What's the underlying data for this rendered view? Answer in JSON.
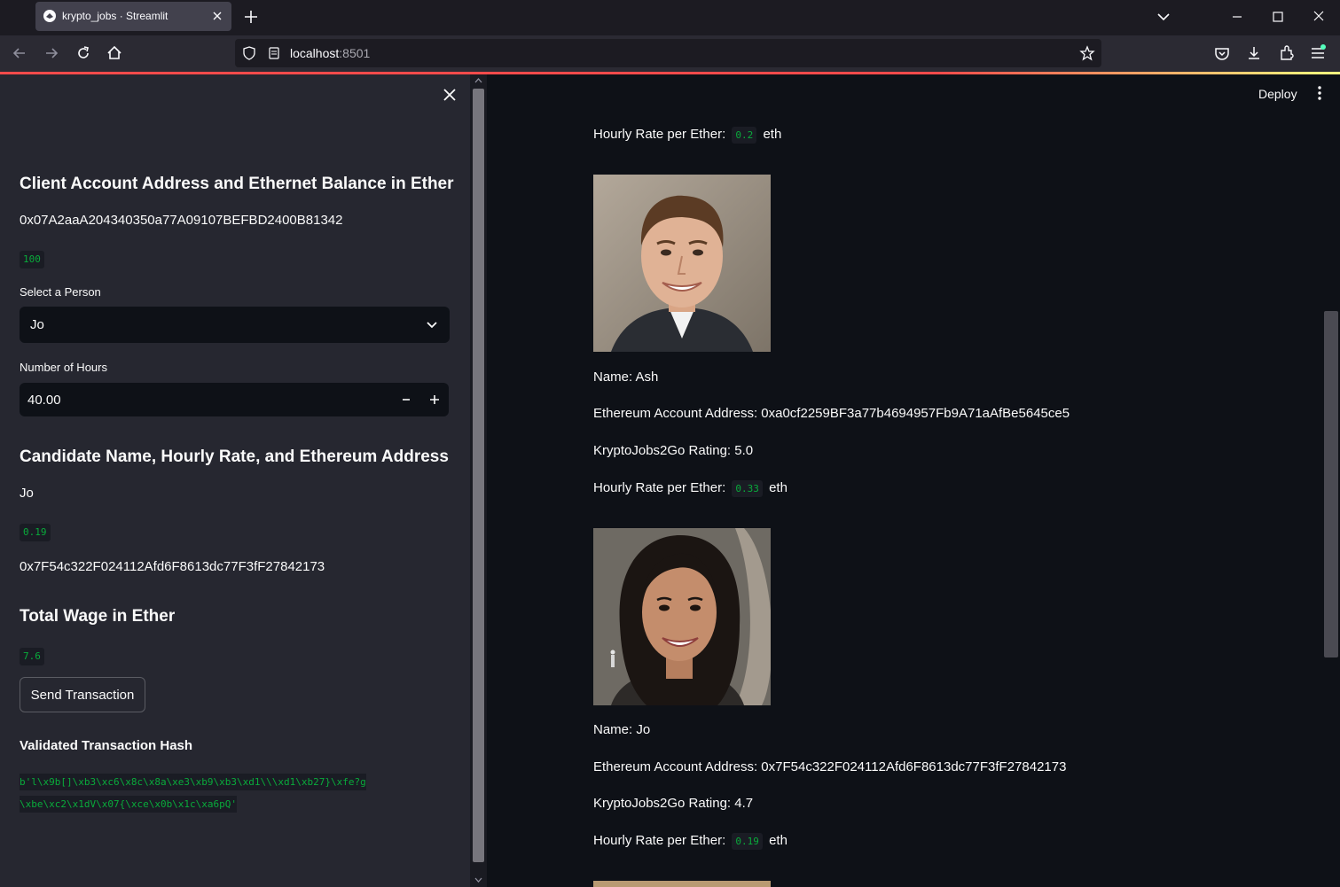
{
  "browser": {
    "tab_title": "krypto_jobs · Streamlit",
    "url_host": "localhost",
    "url_port": ":8501"
  },
  "sidebar": {
    "client_heading": "Client Account Address and Ethernet Balance in Ether",
    "client_address": "0x07A2aaA204340350a77A09107BEFBD2400B81342",
    "client_balance": "100",
    "select_person_label": "Select a Person",
    "select_person_value": "Jo",
    "hours_label": "Number of Hours",
    "hours_value": "40.00",
    "candidate_heading": "Candidate Name, Hourly Rate, and Ethereum Address",
    "candidate_name": "Jo",
    "candidate_rate": "0.19",
    "candidate_address": "0x7F54c322F024112Afd6F8613dc77F3fF27842173",
    "wage_heading": "Total Wage in Ether",
    "wage_value": "7.6",
    "send_button": "Send Transaction",
    "hash_heading": "Validated Transaction Hash",
    "hash_line1": "b'l\\x9b[]\\xb3\\xc6\\x8c\\x8a\\xe3\\xb9\\xb3\\xd1\\\\\\xd1\\xb27}\\xfe?g",
    "hash_line2": "\\xbe\\xc2\\x1dV\\x07{\\xce\\x0b\\x1c\\xa6pQ'"
  },
  "main": {
    "deploy": "Deploy",
    "rate_label": "Hourly Rate per Ether:",
    "rate_unit": "eth",
    "top_rate": "0.2",
    "name_prefix": "Name:",
    "address_prefix": "Ethereum Account Address:",
    "rating_prefix": "KryptoJobs2Go Rating:",
    "candidates": [
      {
        "name": "Ash",
        "address": "0xa0cf2259BF3a77b4694957Fb9A71aAfBe5645ce5",
        "rating": "5.0",
        "rate": "0.33"
      },
      {
        "name": "Jo",
        "address": "0x7F54c322F024112Afd6F8613dc77F3fF27842173",
        "rating": "4.7",
        "rate": "0.19"
      }
    ]
  },
  "colors": {
    "code_green": "#09ab3b",
    "sidebar_bg": "#262730",
    "main_bg": "#0e1117",
    "accent_red": "#ff4b4b"
  }
}
